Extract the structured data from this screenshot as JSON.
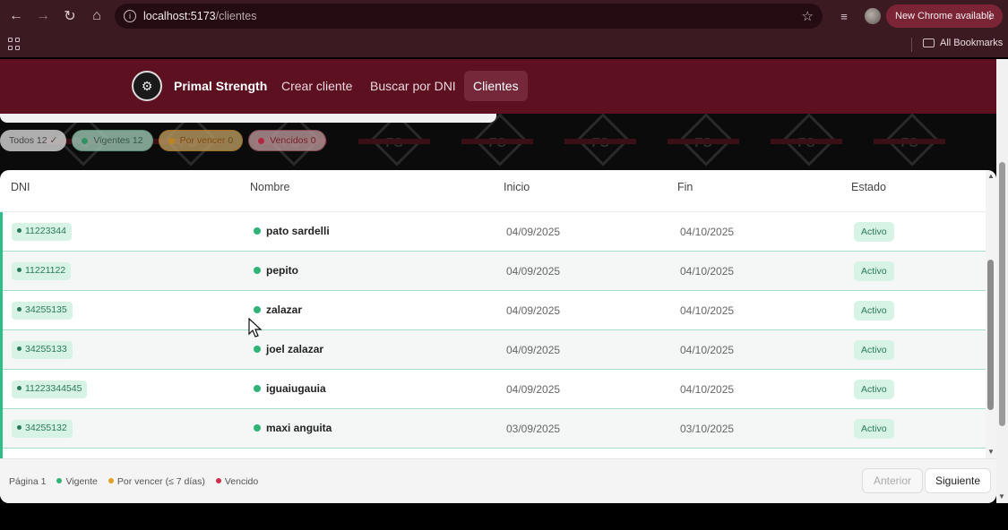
{
  "browser": {
    "url_host": "localhost:5173",
    "url_path": "/clientes",
    "new_chrome": "New Chrome available",
    "all_bookmarks": "All Bookmarks"
  },
  "header": {
    "brand": "Primal Strength",
    "nav": [
      {
        "label": "Crear cliente"
      },
      {
        "label": "Buscar por DNI"
      },
      {
        "label": "Clientes"
      }
    ]
  },
  "filters": [
    {
      "label": "Todos 12 ✓"
    },
    {
      "label": "Vigentes 12"
    },
    {
      "label": "Por vencer 0"
    },
    {
      "label": "Vencidos 0"
    }
  ],
  "table": {
    "columns": [
      "DNI",
      "Nombre",
      "Inicio",
      "Fin",
      "Estado"
    ],
    "rows": [
      {
        "dni": "11223344",
        "nombre": "pato sardelli",
        "inicio": "04/09/2025",
        "fin": "04/10/2025",
        "estado": "Activo"
      },
      {
        "dni": "11221122",
        "nombre": "pepito",
        "inicio": "04/09/2025",
        "fin": "04/10/2025",
        "estado": "Activo"
      },
      {
        "dni": "34255135",
        "nombre": "zalazar",
        "inicio": "04/09/2025",
        "fin": "04/10/2025",
        "estado": "Activo"
      },
      {
        "dni": "34255133",
        "nombre": "joel zalazar",
        "inicio": "04/09/2025",
        "fin": "04/10/2025",
        "estado": "Activo"
      },
      {
        "dni": "11223344545",
        "nombre": "iguaiugauia",
        "inicio": "04/09/2025",
        "fin": "04/10/2025",
        "estado": "Activo"
      },
      {
        "dni": "34255132",
        "nombre": "maxi anguita",
        "inicio": "03/09/2025",
        "fin": "03/10/2025",
        "estado": "Activo"
      }
    ]
  },
  "footer": {
    "page": "Página 1",
    "legend": [
      "Vigente",
      "Por vencer (≤ 7 días)",
      "Vencido"
    ],
    "prev": "Anterior",
    "next": "Siguiente"
  },
  "colors": {
    "vigente": "#2fb377",
    "por_vencer": "#e0a020",
    "vencido": "#d0304a",
    "header_bg": "#5c1020"
  }
}
